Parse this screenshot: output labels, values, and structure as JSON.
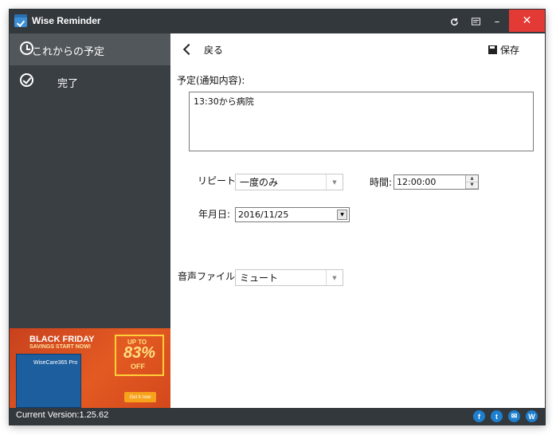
{
  "window": {
    "title": "Wise Reminder"
  },
  "titlebar_buttons": {
    "refresh_icon": "refresh-icon",
    "menu_icon": "menu-icon",
    "minimize": "–",
    "close": "✕"
  },
  "sidebar": {
    "items": [
      {
        "label": "これからの予定",
        "icon": "clock-icon",
        "active": true
      },
      {
        "label": "完了",
        "icon": "check-circle-icon",
        "active": false
      }
    ]
  },
  "ad": {
    "headline": "BLACK FRIDAY",
    "subline": "SAVINGS START NOW!",
    "product": "WiseCare365 Pro",
    "upto": "UP TO",
    "percent": "83%",
    "off": "OFF",
    "cta": "Get it now",
    "accent": "#e35a22"
  },
  "toolbar": {
    "back_label": "戻る",
    "save_label": "保存"
  },
  "form": {
    "memo_label": "予定(通知内容):",
    "memo_value": "13:30から病院",
    "repeat_label": "リピート:",
    "repeat_value": "一度のみ",
    "time_label": "時間:",
    "time_value": "12:00:00",
    "date_label": "年月日:",
    "date_value": "2016/11/25",
    "sound_label": "音声ファイル",
    "sound_value": "ミュート"
  },
  "statusbar": {
    "version": "Current Version:1.25.62",
    "social": [
      "f",
      "t",
      "✉",
      "W"
    ],
    "social_icons": [
      "facebook-icon",
      "twitter-icon",
      "mail-icon",
      "website-icon"
    ]
  },
  "colors": {
    "titlebar": "#33383d",
    "sidebar": "#3a3f44",
    "active_item": "#52575c",
    "close": "#e33a35",
    "social": "#1e7fcf"
  }
}
